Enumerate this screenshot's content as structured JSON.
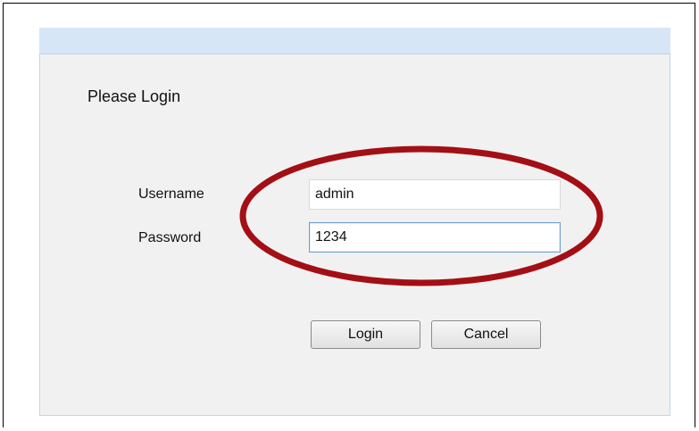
{
  "form": {
    "title": "Please Login",
    "username_label": "Username",
    "username_value": "admin",
    "password_label": "Password",
    "password_value": "1234",
    "login_label": "Login",
    "cancel_label": "Cancel"
  },
  "annotation": {
    "highlight_color": "#a30f14"
  }
}
